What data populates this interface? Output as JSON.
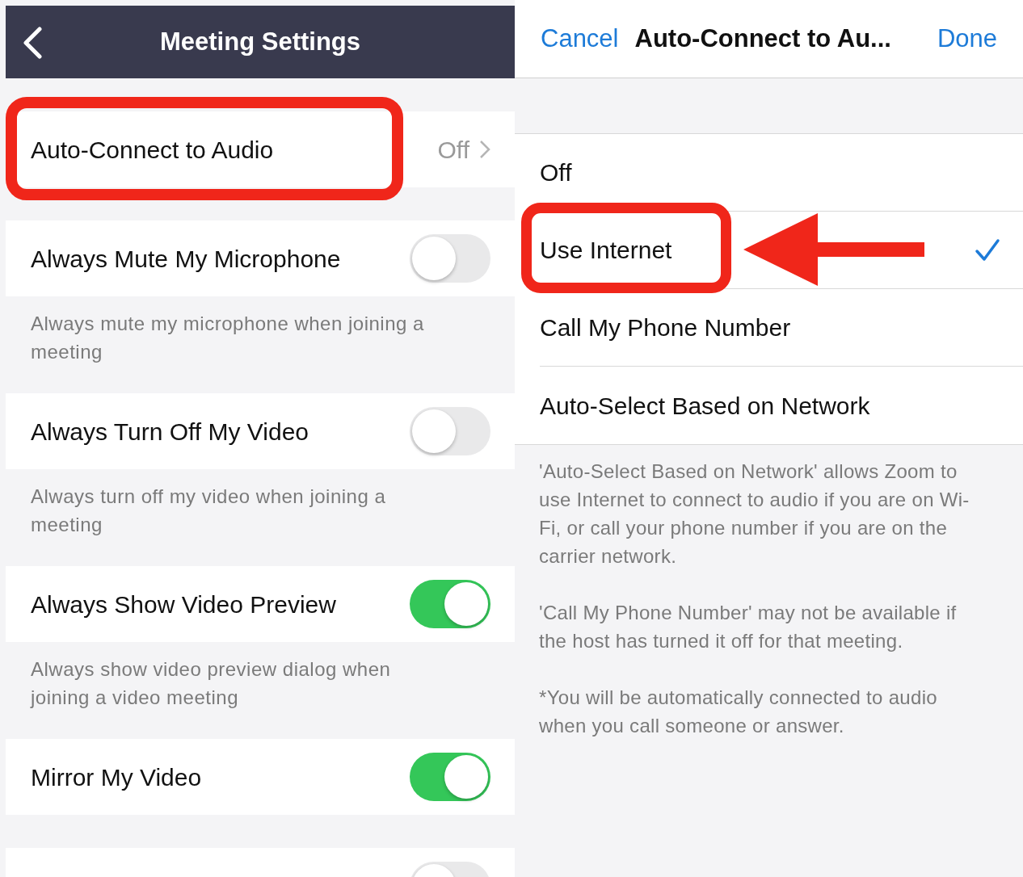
{
  "settings_screen": {
    "title": "Meeting Settings",
    "sections": [
      {
        "rows": [
          {
            "kind": "value",
            "label": "Auto-Connect to Audio",
            "value": "Off"
          }
        ]
      },
      {
        "rows": [
          {
            "kind": "toggle",
            "label": "Always Mute My Microphone",
            "on": false,
            "description": "Always mute my microphone when joining a meeting"
          },
          {
            "kind": "toggle",
            "label": "Always Turn Off My Video",
            "on": false,
            "description": "Always turn off my video when joining a meeting"
          },
          {
            "kind": "toggle",
            "label": "Always Show Video Preview",
            "on": true,
            "description": "Always show video preview dialog when joining a video meeting"
          },
          {
            "kind": "toggle",
            "label": "Mirror My Video",
            "on": true
          }
        ]
      },
      {
        "rows": [
          {
            "kind": "toggle",
            "on": false
          }
        ]
      }
    ]
  },
  "audio_screen": {
    "cancel": "Cancel",
    "title": "Auto-Connect to Au...",
    "done": "Done",
    "options": [
      {
        "label": "Off",
        "selected": false
      },
      {
        "label": "Use Internet",
        "selected": true
      },
      {
        "label": "Call My Phone Number",
        "selected": false
      },
      {
        "label": "Auto-Select Based on Network",
        "selected": false
      }
    ],
    "notes": [
      "'Auto-Select Based on Network' allows Zoom to use Internet to connect to audio if you are on Wi-Fi, or call your phone number if you are on the carrier network.",
      "'Call My Phone Number' may not be available if the host has turned it off for that meeting.",
      "*You will be automatically connected to audio when you call someone or answer."
    ]
  }
}
